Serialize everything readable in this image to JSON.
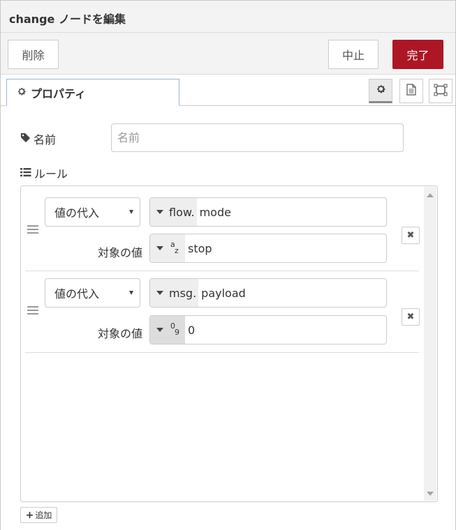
{
  "header": {
    "title": "change ノードを編集"
  },
  "toolbar": {
    "delete_label": "削除",
    "cancel_label": "中止",
    "done_label": "完了",
    "done_color": "#ad1625"
  },
  "tabs": [
    {
      "label": "プロパティ",
      "icon": "gear-icon"
    }
  ],
  "tab_icons": [
    "gear-icon",
    "document-icon",
    "frame-icon"
  ],
  "form": {
    "name_label": "名前",
    "name_placeholder": "名前",
    "rules_label": "ルール",
    "target_label": "対象の値",
    "add_label": "追加"
  },
  "rules": [
    {
      "action": "値の代入",
      "prop_type": "flow.",
      "prop_value": "mode",
      "to_type_icon": "string-type-icon",
      "to_type_top": "a",
      "to_type_bottom": "z",
      "to_value": "stop"
    },
    {
      "action": "値の代入",
      "prop_type": "msg.",
      "prop_value": "payload",
      "to_type_icon": "number-type-icon",
      "to_type_top": "0",
      "to_type_bottom": "9",
      "to_value": "0"
    }
  ]
}
